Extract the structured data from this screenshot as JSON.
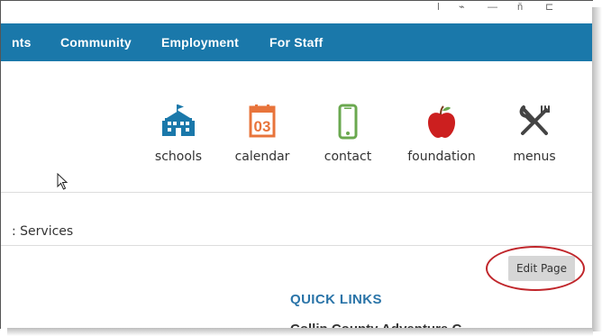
{
  "nav": {
    "items": [
      "nts",
      "Community",
      "Employment",
      "For Staff"
    ]
  },
  "quick_icons": [
    {
      "label": "schools",
      "icon": "school-building-icon",
      "color": "#1a78aa"
    },
    {
      "label": "calendar",
      "icon": "calendar-icon",
      "color": "#e8743b",
      "day": "03"
    },
    {
      "label": "contact",
      "icon": "phone-icon",
      "color": "#6aa84f"
    },
    {
      "label": "foundation",
      "icon": "apple-icon",
      "color": "#cc1f1f"
    },
    {
      "label": "menus",
      "icon": "fork-knife-icon",
      "color": "#444444"
    }
  ],
  "breadcrumb": ": Services",
  "edit_button": "Edit Page",
  "quick_links": {
    "title": "QUICK LINKS",
    "first_item_partial": "Collin County Adventure C"
  },
  "colors": {
    "nav_bg": "#1a78aa",
    "highlight_ring": "#c0262b"
  }
}
